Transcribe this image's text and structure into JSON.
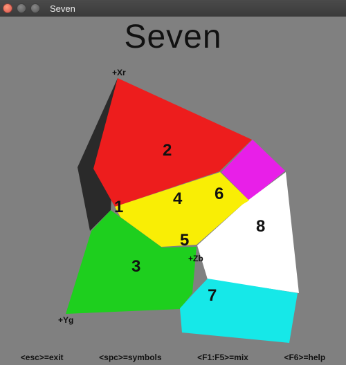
{
  "window": {
    "title": "Seven"
  },
  "heading": "Seven",
  "axis_labels": {
    "xr": "+Xr",
    "yg": "+Yg",
    "zb": "+Zb"
  },
  "regions": {
    "n1": "1",
    "n2": "2",
    "n3": "3",
    "n4": "4",
    "n5": "5",
    "n6": "6",
    "n7": "7",
    "n8": "8"
  },
  "colors": {
    "red": "#ed1d1d",
    "magenta": "#e81fe8",
    "yellow": "#f9ee05",
    "green": "#1ecf1e",
    "white": "#ffffff",
    "cyan": "#16e8e8",
    "black": "#2a2a2a",
    "bg": "#808080"
  },
  "status": {
    "esc": "<esc>=exit",
    "spc": "<spc>=symbols",
    "f15": "<F1:F5>=mix",
    "f6": "<F6>=help"
  }
}
